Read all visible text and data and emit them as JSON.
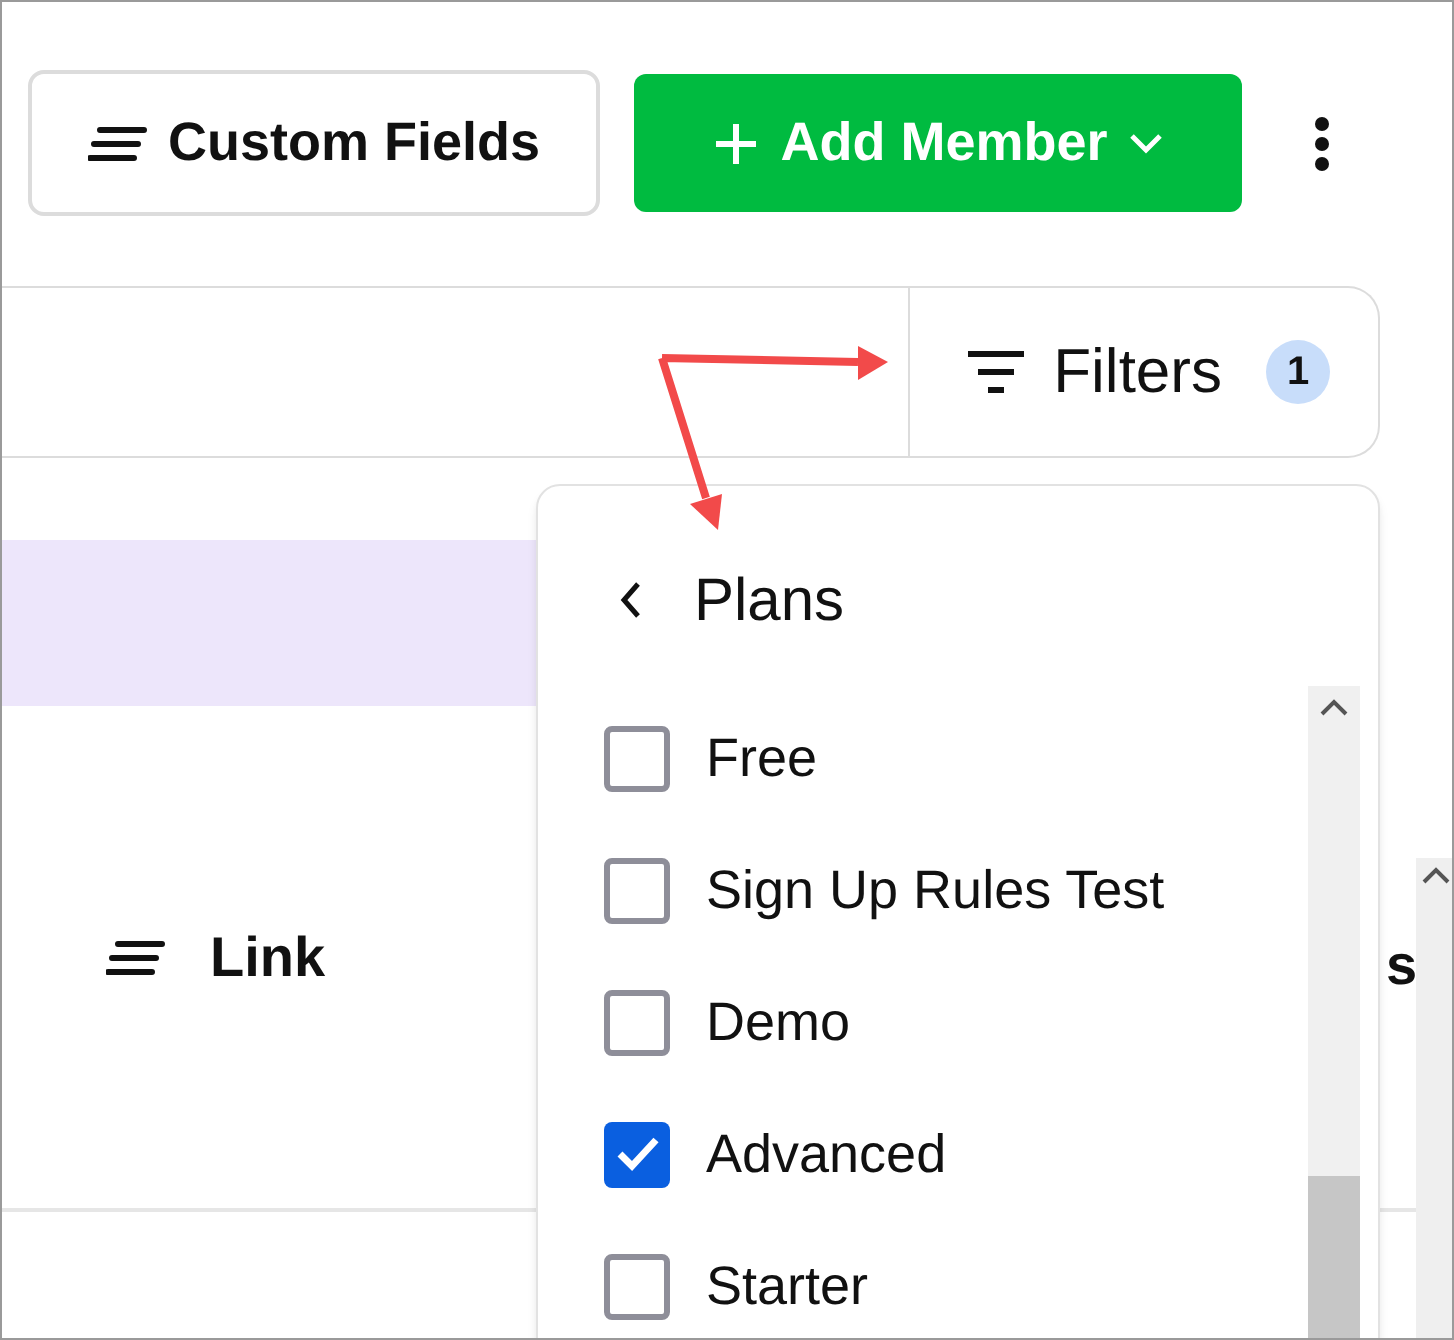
{
  "toolbar": {
    "custom_fields_button": "Custom Fields",
    "add_member_button": "Add Member"
  },
  "filter_bar": {
    "filters_button": "Filters",
    "filter_count": "1"
  },
  "table": {
    "columns": [
      {
        "label": "Link"
      },
      {
        "label": "s"
      }
    ]
  },
  "plans_menu": {
    "title": "Plans",
    "options": [
      {
        "label": "Free",
        "checked": false
      },
      {
        "label": "Sign Up Rules Test",
        "checked": false
      },
      {
        "label": "Demo",
        "checked": false
      },
      {
        "label": "Advanced",
        "checked": true
      },
      {
        "label": "Starter",
        "checked": false
      }
    ]
  }
}
